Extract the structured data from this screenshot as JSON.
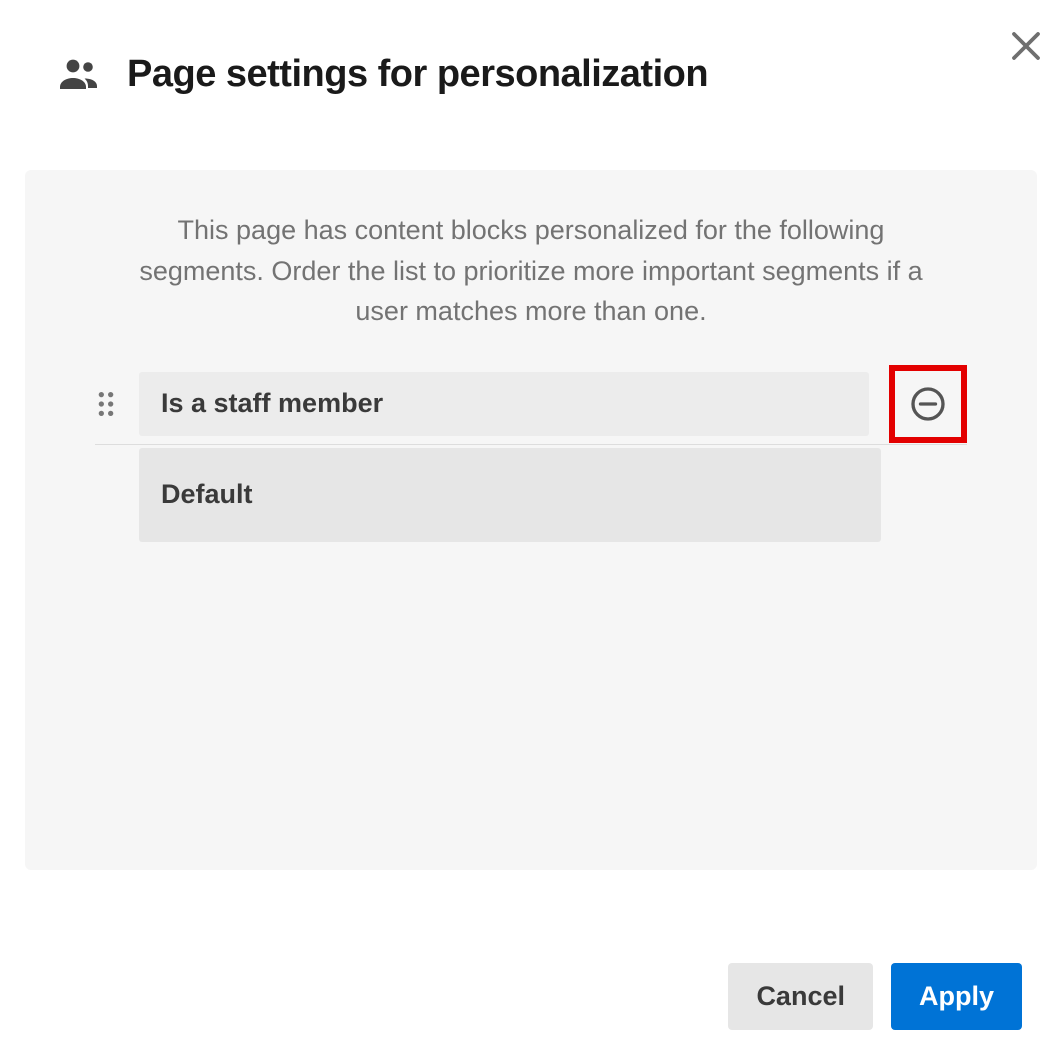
{
  "header": {
    "title": "Page settings for personalization"
  },
  "panel": {
    "description": "This page has content blocks personalized for the following segments. Order the list to prioritize more important segments if a user matches more than one."
  },
  "segments": [
    {
      "label": "Is a staff member"
    }
  ],
  "default_label": "Default",
  "buttons": {
    "cancel": "Cancel",
    "apply": "Apply"
  }
}
